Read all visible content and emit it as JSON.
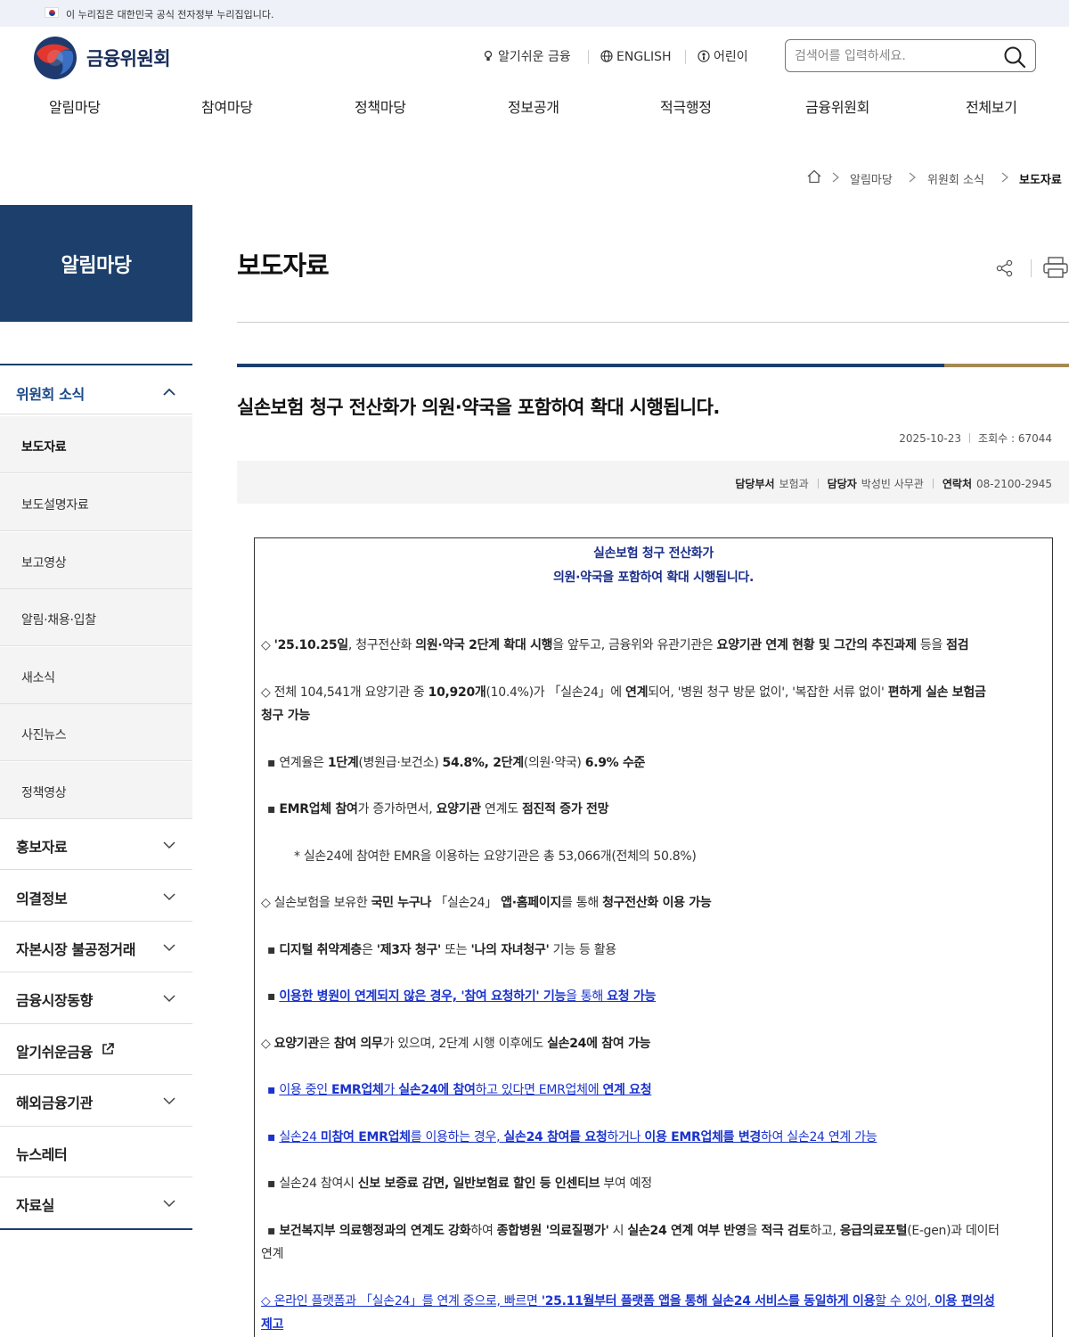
{
  "gov_banner": {
    "text": "이 누리집은 대한민국 공식 전자정부 누리집입니다."
  },
  "header": {
    "logo_text": "금융위원회",
    "util": {
      "easy_finance": "알기쉬운 금융",
      "english": "ENGLISH",
      "kids": "어린이"
    },
    "search_placeholder": "검색어를 입력하세요."
  },
  "gnb": [
    "알림마당",
    "참여마당",
    "정책마당",
    "정보공개",
    "적극행정",
    "금융위원회",
    "전체보기"
  ],
  "breadcrumb": [
    "알림마당",
    "위원회 소식",
    "보도자료"
  ],
  "side": {
    "title": "알림마당",
    "active_group": "위원회 소식",
    "sub_items": [
      "보도자료",
      "보도설명자료",
      "보고영상",
      "알림·채용·입찰",
      "새소식",
      "사진뉴스",
      "정책영상"
    ],
    "groups": [
      "홍보자료",
      "의결정보",
      "자본시장 불공정거래",
      "금융시장동향",
      "알기쉬운금융",
      "해외금융기관",
      "뉴스레터",
      "자료실"
    ]
  },
  "page": {
    "title": "보도자료"
  },
  "article": {
    "title": "실손보험 청구 전산화가 의원·약국을 포함하여 확대 시행됩니다.",
    "date": "2025-10-23",
    "views": "조회수 : 67044",
    "contact": {
      "dept_label": "담당부서",
      "dept": "보험과",
      "person_label": "담당자",
      "person": "박성빈 사무관",
      "phone_label": "연락처",
      "phone": "08-2100-2945"
    }
  },
  "doc": {
    "head1": "실손보험 청구 전산화가",
    "head2": "의원·약국을 포함하여 확대 시행됩니다.",
    "p1": [
      "◇ ",
      "'25.10.25일",
      ", 청구전산화 ",
      "의원·약국 2단계 확대 시행",
      "을 앞두고, 금융위와 유관기관은 ",
      "요양기관 연계 현황 및 그간의 추진과제",
      " 등을 ",
      "점검"
    ],
    "p2a": [
      "◇ 전체 104,541개 요양기관 중 ",
      "10,920개",
      "(10.4%)가 「실손24」에 ",
      "연계",
      "되어, '병원 청구 방문 없이', '복잡한 서류 없이' ",
      "편하게 실손 보험금"
    ],
    "p2b": "청구 가능",
    "p3": [
      "▪ 연계율은 ",
      "1단계",
      "(병원급·보건소) ",
      "54.8%, 2단계",
      "(의원·약국) ",
      "6.9% 수준"
    ],
    "p4": [
      "▪ ",
      "EMR업체 참여",
      "가 증가하면서, ",
      "요양기관",
      " 연계도 ",
      "점진적 증가 전망"
    ],
    "p5": "* 실손24에 참여한 EMR을 이용하는 요양기관은 총 53,066개(전체의 50.8%)",
    "p6": [
      "◇ 실손보험을 보유한 ",
      "국민 누구나",
      " 「실손24」 ",
      "앱·홈페이지",
      "를 통해 ",
      "청구전산화 이용 가능"
    ],
    "p7": [
      "▪ ",
      "디지털 취약계층",
      "은 ",
      "'제3자 청구'",
      " 또는 ",
      "'나의 자녀청구'",
      " 기능 등 활용"
    ],
    "p8": [
      "▪ ",
      "이용한 병원이 연계되지 않은 경우, '참여 요청하기' 기능",
      "을 통해 ",
      "요청 가능"
    ],
    "p9": [
      "◇ ",
      "요양기관",
      "은 ",
      "참여 의무",
      "가 있으며, 2단계 시행 이후에도 ",
      "실손24에 참여 가능"
    ],
    "p10": [
      "▪ ",
      "이용 중인 ",
      "EMR업체",
      "가 ",
      "실손24에 참여",
      "하고 있다면 EMR업체에 ",
      "연계 요청"
    ],
    "p11": [
      "▪ ",
      "실손24 ",
      "미참여 EMR업체",
      "를 이용하는 경우, ",
      "실손24 참여를 요청",
      "하거나 ",
      "이용 EMR업체를 변경",
      "하여 실손24 연계 가능"
    ],
    "p12": [
      "▪ 실손24 참여시 ",
      "신보 보증료 감면, 일반보험료 할인 등 인센티브",
      " 부여 예정"
    ],
    "p13a": [
      "▪ ",
      "보건복지부 의료행정과의 연계도 강화",
      "하여 ",
      "종합병원 '의료질평가'",
      " 시 ",
      "실손24 연계 여부 반영",
      "을 ",
      "적극 검토",
      "하고, ",
      "응급의료포털",
      "(E-gen)과 데이터"
    ],
    "p13b": "연계",
    "p14a": [
      "◇ 온라인 플랫폼과 「실손24」를 연계 중으로, 빠르면 ",
      "'25.11월부터 플랫폼 앱을 통해 실손24 서비스를 동일하게 이용",
      "할 수 있어, ",
      "이용 편의성"
    ],
    "p14b": "제고"
  }
}
